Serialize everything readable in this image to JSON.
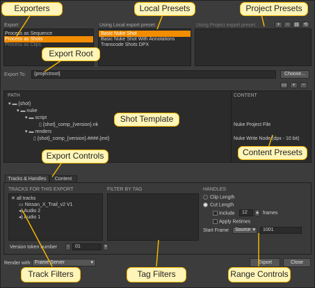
{
  "export_section": {
    "label": "Export",
    "items": [
      "Process as Sequence",
      "Process as Shots",
      "Process as Clips"
    ],
    "selected_index": 1
  },
  "local_presets": {
    "label": "Using Local export preset:",
    "items": [
      "Basic Nuke Shot",
      "Basic Nuke Shot With Annotations",
      "Transcode Shots DPX"
    ],
    "selected_index": 0
  },
  "project_presets": {
    "label": "Using Project export preset:"
  },
  "export_to": {
    "label": "Export To:",
    "value": "{projectroot}",
    "choose_label": "Choose..."
  },
  "tree": {
    "col_path": "PATH",
    "col_content": "CONTENT",
    "rows": [
      {
        "name": "{shot}",
        "content": ""
      },
      {
        "name": "nuke",
        "content": ""
      },
      {
        "name": "script",
        "content": ""
      },
      {
        "name": "{shot}_comp_{version}.nk",
        "content": "Nuke Project File"
      },
      {
        "name": "renders",
        "content": ""
      },
      {
        "name": "{shot}_comp_{version}.####.{ext}",
        "content": "Nuke Write Node (dpx - 10 bit)"
      }
    ]
  },
  "tabs": [
    "Tracks & Handles",
    "Content"
  ],
  "tracks": {
    "header": "TRACKS FOR THIS EXPORT",
    "items": [
      "all tracks",
      "Nissan_X_Trail_v2 V1",
      "Audio 2",
      "Audio 1"
    ]
  },
  "filter_by_tag": {
    "header": "FILTER BY TAG"
  },
  "handles": {
    "header": "HANDLES",
    "clip_length": "Clip Length",
    "cut_length": "Cut Length",
    "include": "Include",
    "include_value": "12",
    "frames": "frames",
    "apply_retimes": "Apply Retimes",
    "start_frame": "Start Frame",
    "start_frame_mode": "Source",
    "start_frame_value": "1001"
  },
  "version": {
    "label": "Version token number",
    "minus": "-",
    "value": "01",
    "plus": "+"
  },
  "render": {
    "label": "Render with:",
    "value": "Frame Server"
  },
  "footer": {
    "export_label": "Export",
    "close_label": "Close"
  },
  "callouts": {
    "exporters": "Exporters",
    "local_presets": "Local Presets",
    "project_presets": "Project Presets",
    "export_root": "Export Root",
    "shot_template": "Shot Template",
    "export_controls": "Export Controls",
    "content_presets": "Content Presets",
    "track_filters": "Track Filters",
    "tag_filters": "Tag Filters",
    "range_controls": "Range Controls"
  }
}
